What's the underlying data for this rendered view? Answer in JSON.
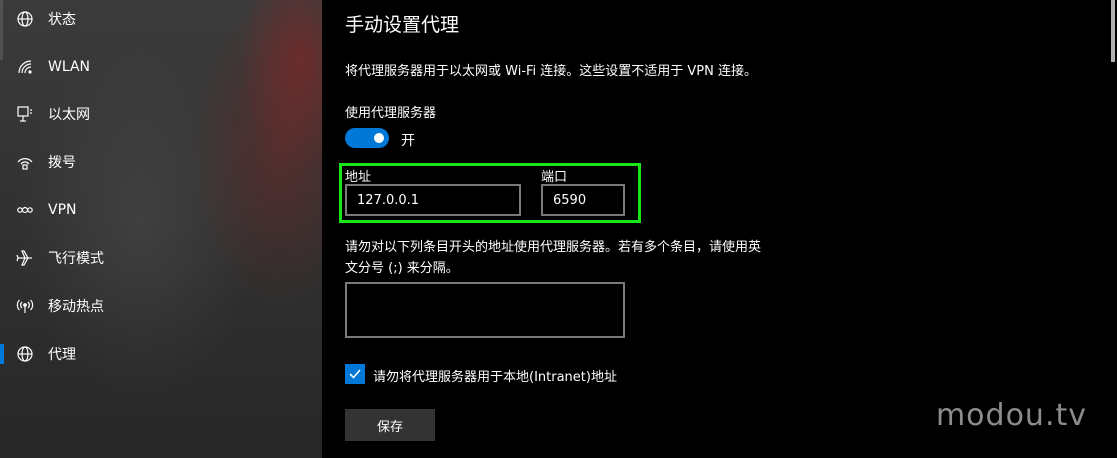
{
  "sidebar": {
    "items": [
      {
        "label": "状态",
        "icon": "globe-icon"
      },
      {
        "label": "WLAN",
        "icon": "wifi-icon"
      },
      {
        "label": "以太网",
        "icon": "ethernet-icon"
      },
      {
        "label": "拨号",
        "icon": "dialup-icon"
      },
      {
        "label": "VPN",
        "icon": "vpn-icon"
      },
      {
        "label": "飞行模式",
        "icon": "airplane-icon"
      },
      {
        "label": "移动热点",
        "icon": "hotspot-icon"
      },
      {
        "label": "代理",
        "icon": "globe-icon",
        "selected": true
      }
    ]
  },
  "main": {
    "title": "手动设置代理",
    "description": "将代理服务器用于以太网或 Wi-Fi 连接。这些设置不适用于 VPN 连接。",
    "use_proxy_label": "使用代理服务器",
    "toggle_state": "开",
    "address_label": "地址",
    "address_value": "127.0.0.1",
    "port_label": "端口",
    "port_value": "6590",
    "exceptions_desc_line1": "请勿对以下列条目开头的地址使用代理服务器。若有多个条目，请使用英",
    "exceptions_desc_line2": "文分号 (;) 来分隔。",
    "exceptions_value": "",
    "bypass_local_label": "请勿将代理服务器用于本地(Intranet)地址",
    "bypass_local_checked": true,
    "save_label": "保存"
  },
  "watermark": "modou.tv",
  "colors": {
    "accent": "#0078d7",
    "highlight": "#19e619",
    "background": "#000000"
  }
}
